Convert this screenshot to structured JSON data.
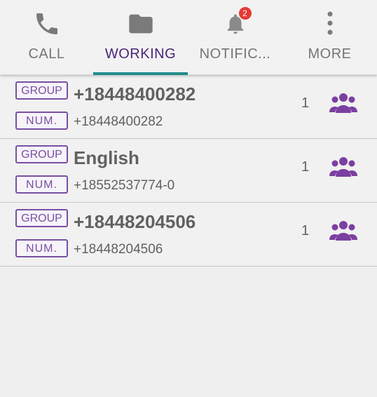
{
  "tabs": [
    {
      "label": "CALL",
      "icon": "phone-icon",
      "active": false
    },
    {
      "label": "WORKING",
      "icon": "folder-icon",
      "active": true
    },
    {
      "label": "NOTIFIC...",
      "icon": "bell-icon",
      "active": false,
      "badge": "2"
    },
    {
      "label": "MORE",
      "icon": "more-vertical-icon",
      "active": false
    }
  ],
  "colors": {
    "accent": "#4a2577",
    "underline": "#1f8c8c",
    "tag": "#7a4fa3",
    "badge": "#e53935"
  },
  "rows": [
    {
      "group_tag": "GROUP",
      "num_tag": "NUM.",
      "title": "+18448400282",
      "number": "+18448400282",
      "count": "1",
      "icon": "group-icon"
    },
    {
      "group_tag": "GROUP",
      "num_tag": "NUM.",
      "title": "English",
      "number": "+18552537774-0",
      "count": "1",
      "icon": "group-icon"
    },
    {
      "group_tag": "GROUP",
      "num_tag": "NUM.",
      "title": "+18448204506",
      "number": "+18448204506",
      "count": "1",
      "icon": "group-icon"
    }
  ]
}
